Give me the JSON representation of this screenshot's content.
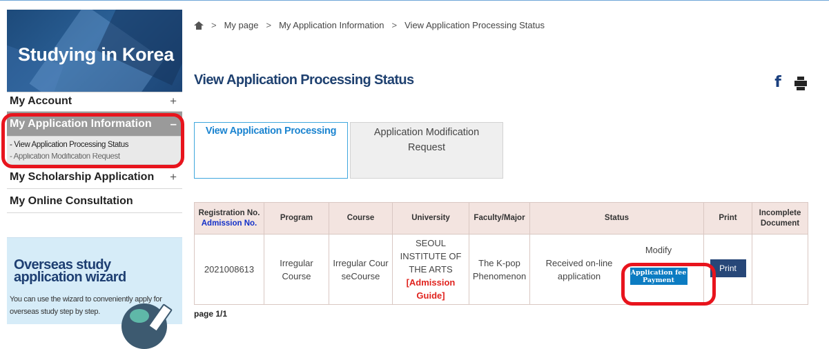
{
  "sidebar": {
    "banner_title": "Studying in Korea",
    "menu": [
      {
        "label": "My Account",
        "toggle": "+"
      },
      {
        "label": "My Application Information",
        "toggle": "–",
        "active": true
      },
      {
        "label": "My Scholarship Application",
        "toggle": "+"
      },
      {
        "label": "My Online Consultation"
      }
    ],
    "submenu": [
      {
        "label": "- View Application Processing Status"
      },
      {
        "label": "- Application Modification Request"
      }
    ],
    "wizard": {
      "title": "Overseas study application wizard",
      "description": "You can use the wizard to conveniently apply for overseas study step by step."
    }
  },
  "breadcrumb": {
    "home_icon": "home-icon",
    "separator": ">",
    "items": [
      "My page",
      "My Application Information",
      "View Application Processing Status"
    ]
  },
  "main": {
    "title": "View Application Processing Status",
    "share_icon": "facebook-icon",
    "print_icon": "print-icon",
    "facebook_glyph": "f",
    "tabs": [
      {
        "label": "View Application Processing",
        "active": true
      },
      {
        "label": "Application Modification Request",
        "active": false
      }
    ]
  },
  "table": {
    "headers": {
      "registration_no": "Registration No.",
      "admission_no": "Admission No.",
      "program": "Program",
      "course": "Course",
      "university": "University",
      "faculty": "Faculty/Major",
      "status": "Status",
      "print": "Print",
      "incomplete": "Incomplete Document"
    },
    "row": {
      "registration_no": "2021008613",
      "program": "Irregular Course",
      "course": "Irregular CourseCourse",
      "university": "SEOUL INSTITUTE OF THE ARTS",
      "admission_guide": "[Admission Guide]",
      "faculty": "The K-pop Phenomenon",
      "status": "Received on-line application",
      "modify": "Modify",
      "fee_button": "Application fee Payment",
      "print_button": "Print",
      "incomplete": ""
    }
  },
  "pager": "page 1/1",
  "colors": {
    "accent_red": "#e8141d",
    "title_navy": "#1f4170",
    "tab_active": "#1b84d0",
    "fee_button": "#0c7cc2"
  }
}
